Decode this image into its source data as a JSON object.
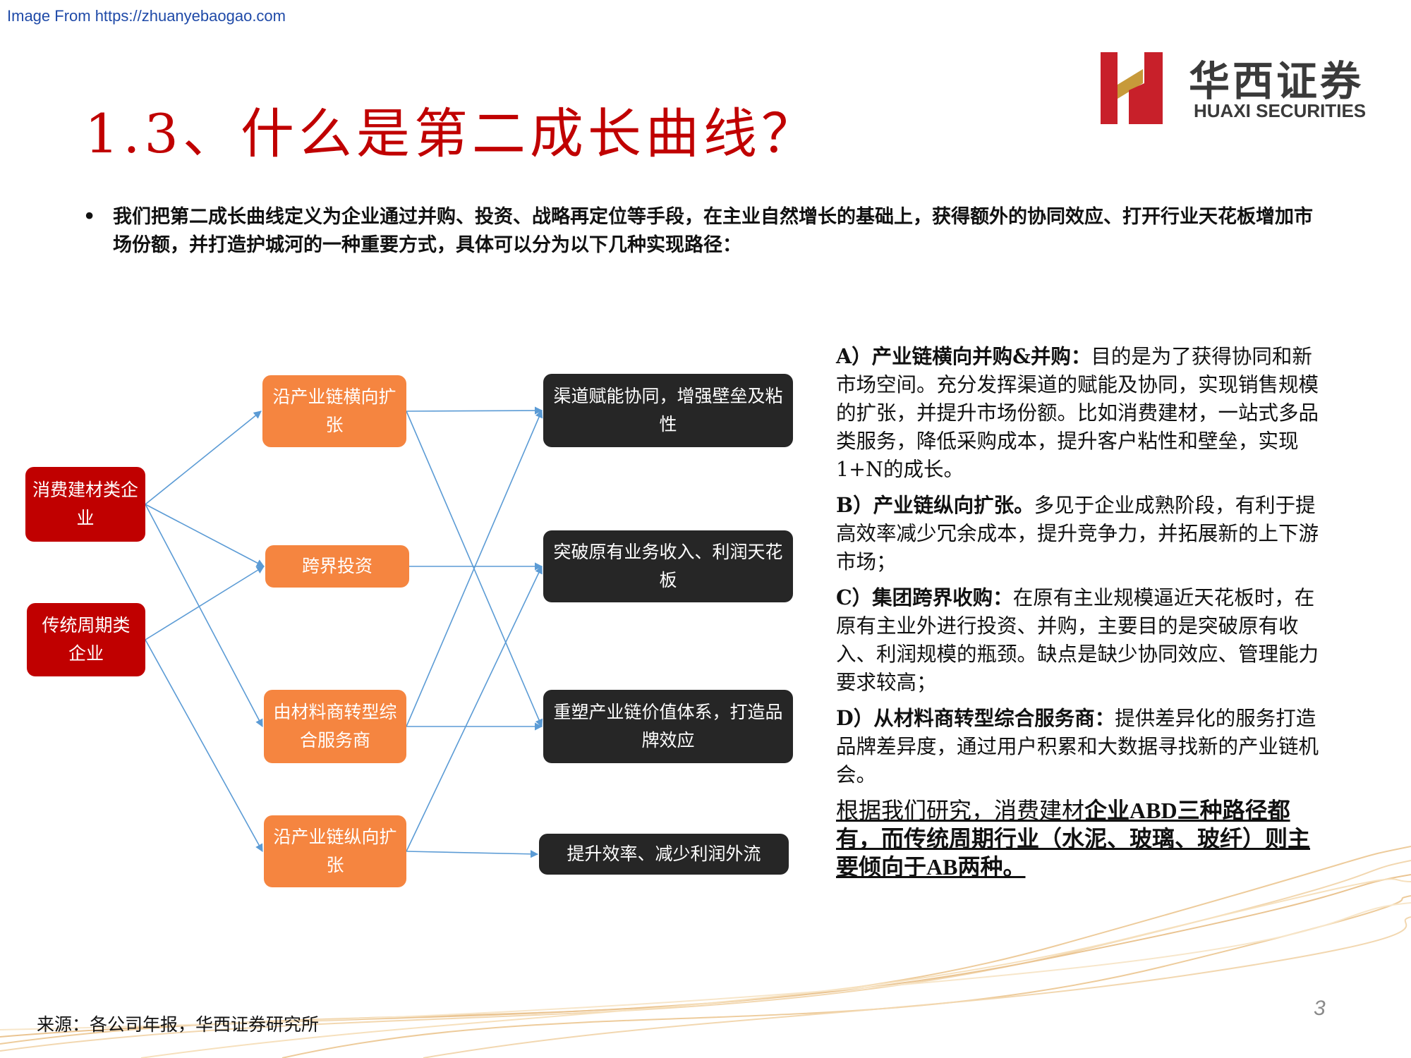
{
  "watermark": "Image From https://zhuanyebaogao.com",
  "title": "1.3、什么是第二成长曲线？",
  "logo": {
    "cn": "华西证券",
    "en": "HUAXI SECURITIES",
    "mark_color": "#c8202a"
  },
  "intro": "我们把第二成长曲线定义为企业通过并购、投资、战略再定位等手段，在主业自然增长的基础上，获得额外的协同效应、打开行业天花板增加市场份额，并打造护城河的一种重要方式，具体可以分为以下几种实现路径：",
  "diagram": {
    "sources": [
      {
        "id": "s1",
        "label": "消费建材类企业"
      },
      {
        "id": "s2",
        "label": "传统周期类企业"
      }
    ],
    "paths": [
      {
        "id": "p1",
        "label": "沿产业链横向扩张"
      },
      {
        "id": "p2",
        "label": "跨界投资"
      },
      {
        "id": "p3",
        "label": "由材料商转型综合服务商"
      },
      {
        "id": "p4",
        "label": "沿产业链纵向扩张"
      }
    ],
    "outcomes": [
      {
        "id": "o1",
        "label": "渠道赋能协同，增强壁垒及粘性"
      },
      {
        "id": "o2",
        "label": "突破原有业务收入、利润天花板"
      },
      {
        "id": "o3",
        "label": "重塑产业链价值体系，打造品牌效应"
      },
      {
        "id": "o4",
        "label": "提升效率、减少利润外流"
      }
    ],
    "edges": [
      [
        "s1",
        "p1"
      ],
      [
        "s1",
        "p2"
      ],
      [
        "s1",
        "p3"
      ],
      [
        "s2",
        "p2"
      ],
      [
        "s2",
        "p4"
      ],
      [
        "p1",
        "o1"
      ],
      [
        "p1",
        "o3"
      ],
      [
        "p2",
        "o2"
      ],
      [
        "p3",
        "o1"
      ],
      [
        "p3",
        "o3"
      ],
      [
        "p4",
        "o2"
      ],
      [
        "p4",
        "o4"
      ]
    ],
    "colors": {
      "source": "#c00000",
      "path": "#f58540",
      "outcome": "#262626",
      "edge": "#5b9bd5"
    }
  },
  "paths_text": [
    {
      "heading": "A）产业链横向并购&并购：",
      "body": "目的是为了获得协同和新市场空间。充分发挥渠道的赋能及协同，实现销售规模的扩张，并提升市场份额。比如消费建材，一站式多品类服务，降低采购成本，提升客户粘性和壁垒，实现1+N的成长。"
    },
    {
      "heading": "B）产业链纵向扩张。",
      "body": "多见于企业成熟阶段，有利于提高效率减少冗余成本，提升竞争力，并拓展新的上下游市场；"
    },
    {
      "heading": "C）集团跨界收购：",
      "body": "在原有主业规模逼近天花板时，在原有主业外进行投资、并购，主要目的是突破原有收入、利润规模的瓶颈。缺点是缺少协同效应、管理能力要求较高；"
    },
    {
      "heading": "D）从材料商转型综合服务商：",
      "body": "提供差异化的服务打造品牌差异度，通过用户积累和大数据寻找新的产业链机会。"
    }
  ],
  "conclusion": {
    "prefix": "根据我们研究，消费建材",
    "emphasis": "企业ABD三种路径都有，而传统周期行业（水泥、玻璃、玻纤）则主要倾向于AB两种。"
  },
  "source": "来源：各公司年报，华西证券研究所",
  "page_number": "3"
}
